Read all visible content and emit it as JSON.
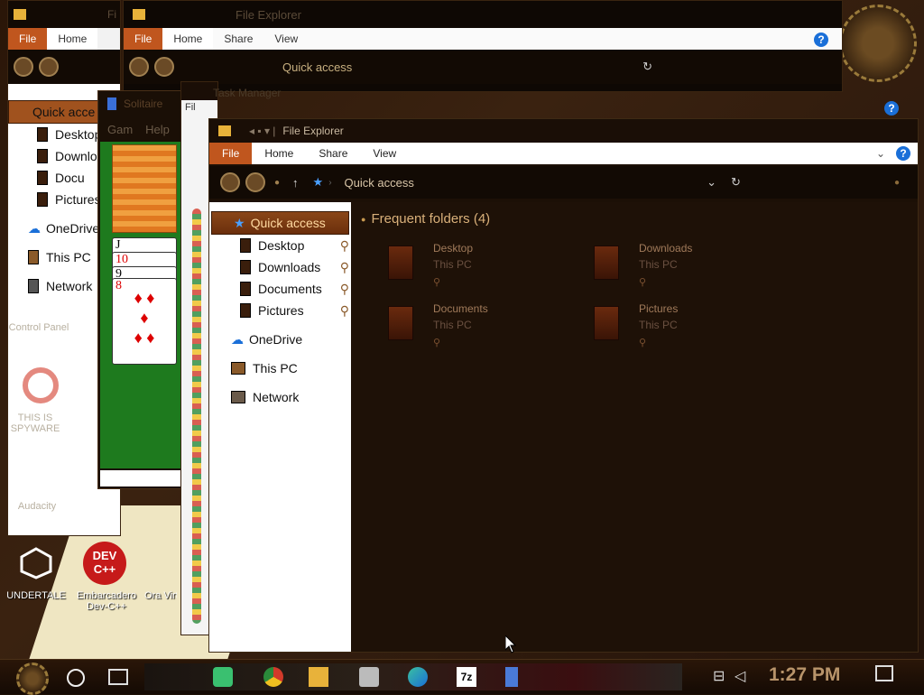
{
  "desktop": {
    "icons": [
      {
        "label": "UNDERTALE"
      },
      {
        "label": "Embarcadero Dev-C++"
      },
      {
        "label": "Ora Virtu"
      },
      {
        "label": "Control Panel"
      },
      {
        "label": "THIS IS SPYWARE"
      },
      {
        "label": "Audacity"
      }
    ]
  },
  "back_explorer": {
    "title": "Fi",
    "ribbon": {
      "file": "File",
      "home": "Home"
    },
    "sidebar": [
      "Quick acce",
      "Desktop",
      "Downlo",
      "Docu",
      "Pictures",
      "OneDrive",
      "This PC",
      "Network"
    ]
  },
  "mid_explorer": {
    "title": "File Explorer",
    "ribbon": {
      "file": "File",
      "home": "Home",
      "share": "Share",
      "view": "View"
    },
    "address": "Quick access"
  },
  "solitaire": {
    "title": "Solitaire",
    "menu": {
      "game": "Gam",
      "help": "Help"
    },
    "cards": [
      "J",
      "10",
      "9",
      "8"
    ]
  },
  "task_manager": {
    "title": "Task Manager",
    "file_menu": "Fil"
  },
  "front_explorer": {
    "title": "File Explorer",
    "ribbon": {
      "file": "File",
      "home": "Home",
      "share": "Share",
      "view": "View"
    },
    "address": "Quick access",
    "sidebar": {
      "quick_access": "Quick access",
      "items": [
        "Desktop",
        "Downloads",
        "Documents",
        "Pictures"
      ],
      "onedrive": "OneDrive",
      "this_pc": "This PC",
      "network": "Network"
    },
    "section_title": "Frequent folders (4)",
    "folders": [
      {
        "name": "Desktop",
        "location": "This PC"
      },
      {
        "name": "Downloads",
        "location": "This PC"
      },
      {
        "name": "Documents",
        "location": "This PC"
      },
      {
        "name": "Pictures",
        "location": "This PC"
      }
    ]
  },
  "taskbar": {
    "time": "1:27 PM",
    "pinned": [
      "start",
      "search",
      "task-view",
      "notes",
      "chrome",
      "file-explorer",
      "paint",
      "edge",
      "7zip",
      "usb"
    ]
  },
  "colors": {
    "accent": "#c0561e",
    "panel": "#1e1107",
    "text_gold": "#d9b07a"
  }
}
